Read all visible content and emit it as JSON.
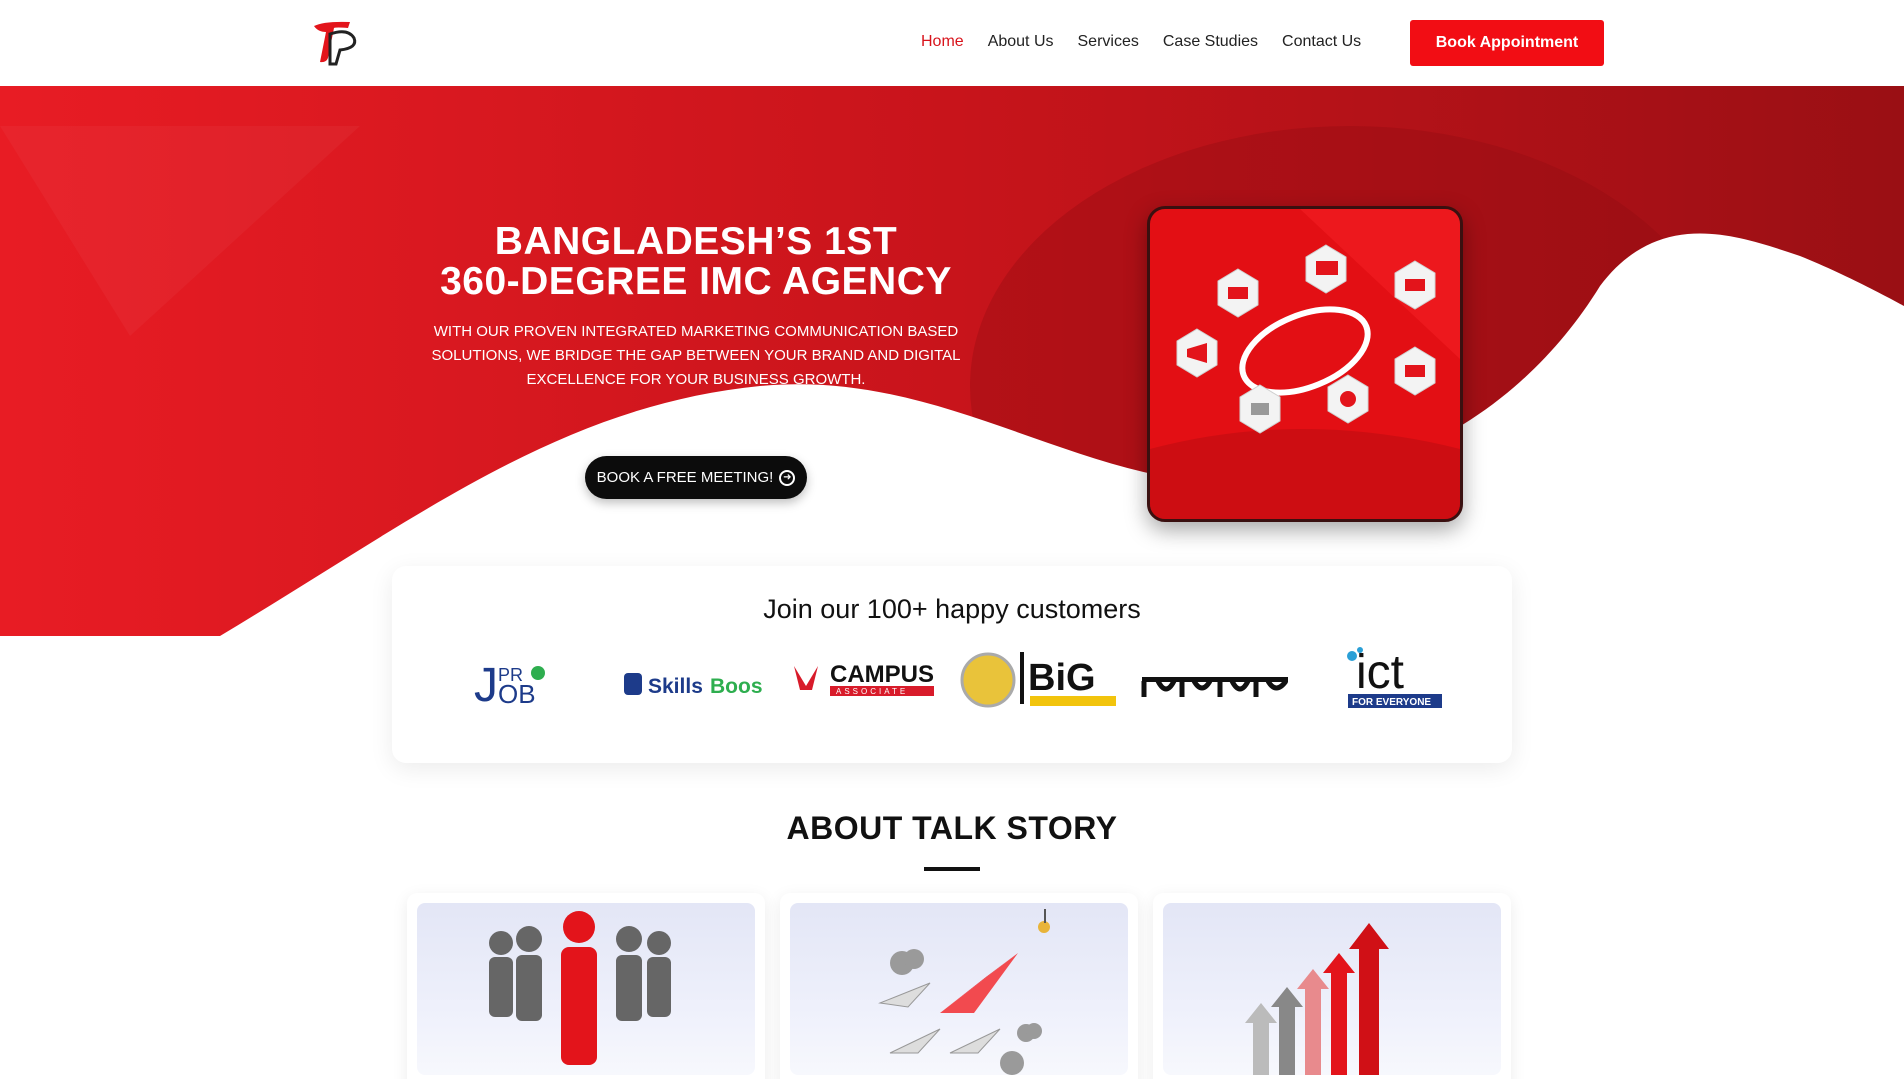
{
  "header": {
    "nav": [
      "Home",
      "About Us",
      "Services",
      "Case Studies",
      "Contact Us"
    ],
    "active_nav": "Home",
    "book_label": "Book Appointment"
  },
  "hero": {
    "title_line1": "BANGLADESH’S 1ST",
    "title_line2": "360-DEGREE IMC AGENCY",
    "subtitle": "WITH OUR PROVEN INTEGRATED MARKETING COMMUNICATION BASED SOLUTIONS, WE BRIDGE THE GAP BETWEEN YOUR BRAND AND DIGITAL EXCELLENCE FOR YOUR BUSINESS GROWTH.",
    "cta_label": "BOOK A FREE MEETING!"
  },
  "customers": {
    "heading": "Join our 100+ happy customers",
    "logos": [
      "Job Pro",
      "Skills Boost",
      "Campus Associate",
      "BiG Bangla News",
      "Kaliakoir Songbad",
      "ict for everyone"
    ]
  },
  "about": {
    "title": "ABOUT TALK STORY"
  },
  "colors": {
    "brand_red": "#f20d14",
    "dark": "#0c0c0c"
  }
}
